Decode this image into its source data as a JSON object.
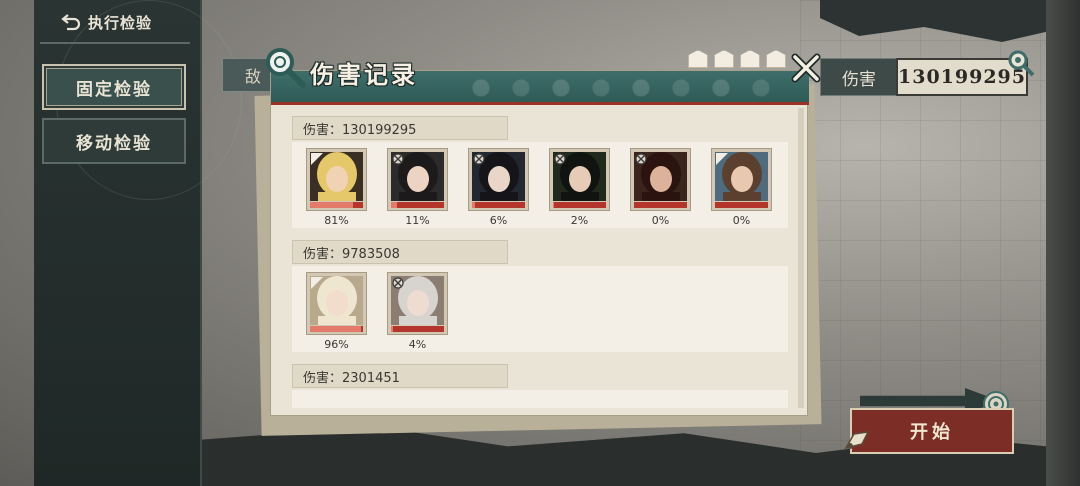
{
  "left_panel": {
    "back_label": "执行检验",
    "nav": [
      {
        "label": "固定检验",
        "active": true
      },
      {
        "label": "移动检验",
        "active": false
      }
    ]
  },
  "enemy_tab_label": "敌",
  "damage_summary": {
    "label": "伤害",
    "value": "130199295"
  },
  "start_button": {
    "label": "开始"
  },
  "modal": {
    "title": "伤害记录",
    "records": [
      {
        "header": "伤害：130199295",
        "characters": [
          {
            "pct": "81%",
            "bar": 0.81,
            "sigil": "flag",
            "portrait": {
              "bg": "#3a2f22",
              "hair": "#e5c86a",
              "skin": "#f1d2b3"
            }
          },
          {
            "pct": "11%",
            "bar": 0.11,
            "sigil": "crossed",
            "portrait": {
              "bg": "#2d2a2a",
              "hair": "#1d1a1c",
              "skin": "#ecd3c2"
            }
          },
          {
            "pct": "6%",
            "bar": 0.06,
            "sigil": "crossed",
            "portrait": {
              "bg": "#232830",
              "hair": "#141419",
              "skin": "#e9d6c8"
            }
          },
          {
            "pct": "2%",
            "bar": 0.02,
            "sigil": "crossed",
            "portrait": {
              "bg": "#1f2a1d",
              "hair": "#101310",
              "skin": "#e6ccb6"
            }
          },
          {
            "pct": "0%",
            "bar": 0.0,
            "sigil": "crossed",
            "portrait": {
              "bg": "#3b241c",
              "hair": "#2b1410",
              "skin": "#dcb29a"
            }
          },
          {
            "pct": "0%",
            "bar": 0.0,
            "sigil": "flag",
            "portrait": {
              "bg": "#4e6c7e",
              "hair": "#5b4030",
              "skin": "#e8c8ae"
            }
          }
        ]
      },
      {
        "header": "伤害：9783508",
        "characters": [
          {
            "pct": "96%",
            "bar": 0.96,
            "sigil": "flag",
            "portrait": {
              "bg": "#b9a98c",
              "hair": "#efe6cf",
              "skin": "#f2dccb"
            }
          },
          {
            "pct": "4%",
            "bar": 0.04,
            "sigil": "crossed",
            "portrait": {
              "bg": "#8c7d72",
              "hair": "#d7d3cf",
              "skin": "#efdcd0"
            }
          }
        ]
      },
      {
        "header": "伤害：2301451",
        "characters": []
      }
    ]
  },
  "colors": {
    "header_teal": "#3f6e6a",
    "accent_red": "#9a3128",
    "paper": "#e9e4d6"
  }
}
